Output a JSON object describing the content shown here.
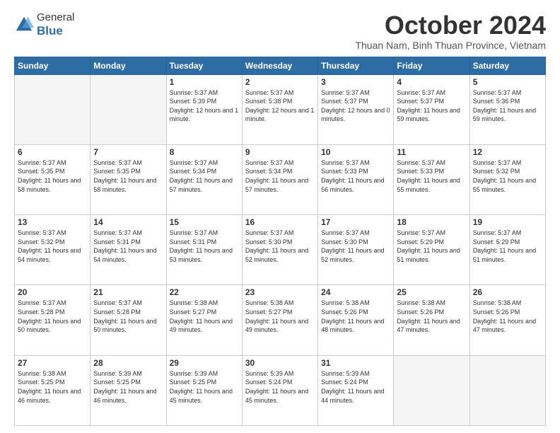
{
  "logo": {
    "general": "General",
    "blue": "Blue"
  },
  "header": {
    "month": "October 2024",
    "location": "Thuan Nam, Binh Thuan Province, Vietnam"
  },
  "days_of_week": [
    "Sunday",
    "Monday",
    "Tuesday",
    "Wednesday",
    "Thursday",
    "Friday",
    "Saturday"
  ],
  "weeks": [
    [
      {
        "day": "",
        "empty": true
      },
      {
        "day": "",
        "empty": true
      },
      {
        "day": "1",
        "sunrise": "5:37 AM",
        "sunset": "5:39 PM",
        "daylight": "12 hours and 1 minute."
      },
      {
        "day": "2",
        "sunrise": "5:37 AM",
        "sunset": "5:38 PM",
        "daylight": "12 hours and 1 minute."
      },
      {
        "day": "3",
        "sunrise": "5:37 AM",
        "sunset": "5:37 PM",
        "daylight": "12 hours and 0 minutes."
      },
      {
        "day": "4",
        "sunrise": "5:37 AM",
        "sunset": "5:37 PM",
        "daylight": "11 hours and 59 minutes."
      },
      {
        "day": "5",
        "sunrise": "5:37 AM",
        "sunset": "5:36 PM",
        "daylight": "11 hours and 59 minutes."
      }
    ],
    [
      {
        "day": "6",
        "sunrise": "5:37 AM",
        "sunset": "5:35 PM",
        "daylight": "11 hours and 58 minutes."
      },
      {
        "day": "7",
        "sunrise": "5:37 AM",
        "sunset": "5:35 PM",
        "daylight": "11 hours and 58 minutes."
      },
      {
        "day": "8",
        "sunrise": "5:37 AM",
        "sunset": "5:34 PM",
        "daylight": "11 hours and 57 minutes."
      },
      {
        "day": "9",
        "sunrise": "5:37 AM",
        "sunset": "5:34 PM",
        "daylight": "11 hours and 57 minutes."
      },
      {
        "day": "10",
        "sunrise": "5:37 AM",
        "sunset": "5:33 PM",
        "daylight": "11 hours and 56 minutes."
      },
      {
        "day": "11",
        "sunrise": "5:37 AM",
        "sunset": "5:33 PM",
        "daylight": "11 hours and 55 minutes."
      },
      {
        "day": "12",
        "sunrise": "5:37 AM",
        "sunset": "5:32 PM",
        "daylight": "11 hours and 55 minutes."
      }
    ],
    [
      {
        "day": "13",
        "sunrise": "5:37 AM",
        "sunset": "5:32 PM",
        "daylight": "11 hours and 54 minutes."
      },
      {
        "day": "14",
        "sunrise": "5:37 AM",
        "sunset": "5:31 PM",
        "daylight": "11 hours and 54 minutes."
      },
      {
        "day": "15",
        "sunrise": "5:37 AM",
        "sunset": "5:31 PM",
        "daylight": "11 hours and 53 minutes."
      },
      {
        "day": "16",
        "sunrise": "5:37 AM",
        "sunset": "5:30 PM",
        "daylight": "11 hours and 52 minutes."
      },
      {
        "day": "17",
        "sunrise": "5:37 AM",
        "sunset": "5:30 PM",
        "daylight": "11 hours and 52 minutes."
      },
      {
        "day": "18",
        "sunrise": "5:37 AM",
        "sunset": "5:29 PM",
        "daylight": "11 hours and 51 minutes."
      },
      {
        "day": "19",
        "sunrise": "5:37 AM",
        "sunset": "5:29 PM",
        "daylight": "11 hours and 51 minutes."
      }
    ],
    [
      {
        "day": "20",
        "sunrise": "5:37 AM",
        "sunset": "5:28 PM",
        "daylight": "11 hours and 50 minutes."
      },
      {
        "day": "21",
        "sunrise": "5:37 AM",
        "sunset": "5:28 PM",
        "daylight": "11 hours and 50 minutes."
      },
      {
        "day": "22",
        "sunrise": "5:38 AM",
        "sunset": "5:27 PM",
        "daylight": "11 hours and 49 minutes."
      },
      {
        "day": "23",
        "sunrise": "5:38 AM",
        "sunset": "5:27 PM",
        "daylight": "11 hours and 49 minutes."
      },
      {
        "day": "24",
        "sunrise": "5:38 AM",
        "sunset": "5:26 PM",
        "daylight": "11 hours and 48 minutes."
      },
      {
        "day": "25",
        "sunrise": "5:38 AM",
        "sunset": "5:26 PM",
        "daylight": "11 hours and 47 minutes."
      },
      {
        "day": "26",
        "sunrise": "5:38 AM",
        "sunset": "5:26 PM",
        "daylight": "11 hours and 47 minutes."
      }
    ],
    [
      {
        "day": "27",
        "sunrise": "5:38 AM",
        "sunset": "5:25 PM",
        "daylight": "11 hours and 46 minutes."
      },
      {
        "day": "28",
        "sunrise": "5:39 AM",
        "sunset": "5:25 PM",
        "daylight": "11 hours and 46 minutes."
      },
      {
        "day": "29",
        "sunrise": "5:39 AM",
        "sunset": "5:25 PM",
        "daylight": "11 hours and 45 minutes."
      },
      {
        "day": "30",
        "sunrise": "5:39 AM",
        "sunset": "5:24 PM",
        "daylight": "11 hours and 45 minutes."
      },
      {
        "day": "31",
        "sunrise": "5:39 AM",
        "sunset": "5:24 PM",
        "daylight": "11 hours and 44 minutes."
      },
      {
        "day": "",
        "empty": true,
        "shaded": true
      },
      {
        "day": "",
        "empty": true,
        "shaded": true
      }
    ]
  ]
}
